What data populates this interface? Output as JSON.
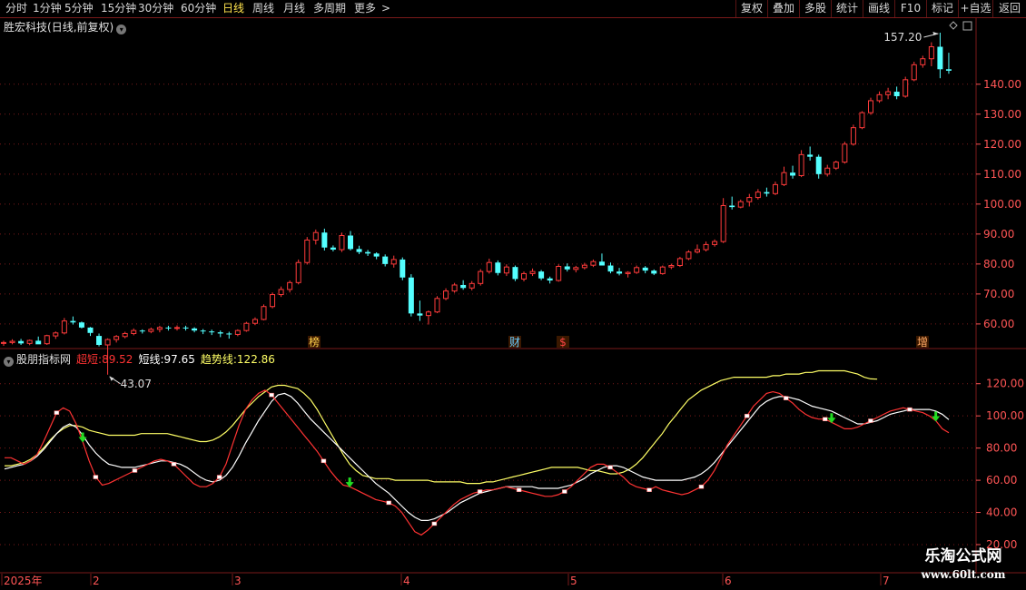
{
  "toolbar": {
    "periods": [
      "分时",
      "1分钟",
      "5分钟",
      "15分钟",
      "30分钟",
      "60分钟",
      "日线",
      "周线",
      "月线",
      "多周期",
      "更多"
    ],
    "active_period": "日线",
    "more_arrow": ">",
    "right_buttons": [
      "复权",
      "叠加",
      "多股",
      "统计",
      "画线",
      "F10",
      "标记",
      "+自选",
      "返回"
    ]
  },
  "stock": {
    "name": "胜宏科技",
    "mode": "(日线,前复权)"
  },
  "indicator": {
    "name": "股朋指标网",
    "legend": [
      {
        "label": "超短",
        "value": "89.52",
        "color": "#ff3333"
      },
      {
        "label": "短线",
        "value": "97.65",
        "color": "#ffffff"
      },
      {
        "label": "趋势线",
        "value": "122.86",
        "color": "#ffff66"
      }
    ]
  },
  "axis": {
    "price_ticks": [
      "140.00",
      "130.00",
      "120.00",
      "110.00",
      "100.00",
      "90.00",
      "80.00",
      "70.00",
      "60.00"
    ],
    "indicator_ticks": [
      "120.00",
      "100.00",
      "80.00",
      "60.00",
      "40.00",
      "20.00"
    ],
    "date_labels": [
      "2025年",
      "2",
      "3",
      "4",
      "5",
      "6",
      "7"
    ]
  },
  "annotations": {
    "high_label": "157.20",
    "low_label": "43.07",
    "event_markers": [
      {
        "text": "榜",
        "color": "#ffd24d"
      },
      {
        "text": "财",
        "color": "#66ccff"
      },
      {
        "text": "$",
        "color": "#ff4444"
      },
      {
        "text": "增",
        "color": "#ffaa66"
      }
    ]
  },
  "colors": {
    "up": "#ff3b3b",
    "down": "#54ffff",
    "grid": "#7a1a1a",
    "axis_text": "#ff5555",
    "trend": "#ffff66",
    "short": "#ffffff",
    "ultra": "#ff3333",
    "signal": "#22dd22"
  },
  "watermark": {
    "line1": "乐淘公式网",
    "line2": "www.60lt.com"
  },
  "chart_data": {
    "type": "candlestick",
    "price_ylim": [
      53,
      157.2
    ],
    "indicator_ylim": [
      20,
      130
    ],
    "candles": [
      [
        53.6,
        54.4,
        52.7,
        53.8
      ],
      [
        53.8,
        54.9,
        53.2,
        54.2
      ],
      [
        54.3,
        55.0,
        53.0,
        53.5
      ],
      [
        53.5,
        54.8,
        52.9,
        54.5
      ],
      [
        54.4,
        55.8,
        53.4,
        53.2
      ],
      [
        53.4,
        56.4,
        53.0,
        56.1
      ],
      [
        56.0,
        57.5,
        55.0,
        57.0
      ],
      [
        57.0,
        62.0,
        56.5,
        61.0
      ],
      [
        61.0,
        62.5,
        59.8,
        60.5
      ],
      [
        60.5,
        60.8,
        58.5,
        58.8
      ],
      [
        58.8,
        59.0,
        56.0,
        57.0
      ],
      [
        56.0,
        56.8,
        52.5,
        53.0
      ],
      [
        53.0,
        55.2,
        43.07,
        54.8
      ],
      [
        54.8,
        56.3,
        53.8,
        55.8
      ],
      [
        55.8,
        57.4,
        55.2,
        56.8
      ],
      [
        56.8,
        58.5,
        56.2,
        57.8
      ],
      [
        57.8,
        58.2,
        56.8,
        57.5
      ],
      [
        57.5,
        58.8,
        56.9,
        58.2
      ],
      [
        58.2,
        59.4,
        57.2,
        58.8
      ],
      [
        58.8,
        59.4,
        57.8,
        58.6
      ],
      [
        58.6,
        59.5,
        57.8,
        58.8
      ],
      [
        58.8,
        59.4,
        57.8,
        58.5
      ],
      [
        58.5,
        58.9,
        57.2,
        57.8
      ],
      [
        57.8,
        58.3,
        56.6,
        57.5
      ],
      [
        57.5,
        58.1,
        56.3,
        57.2
      ],
      [
        57.2,
        57.8,
        55.6,
        56.8
      ],
      [
        56.8,
        57.4,
        55.1,
        56.5
      ],
      [
        56.5,
        58.2,
        55.9,
        57.8
      ],
      [
        57.8,
        60.7,
        57.4,
        60.2
      ],
      [
        60.2,
        62.2,
        59.6,
        61.5
      ],
      [
        61.5,
        66.5,
        61.2,
        65.8
      ],
      [
        65.8,
        70.5,
        65.2,
        69.8
      ],
      [
        69.8,
        72.5,
        69.0,
        71.5
      ],
      [
        71.5,
        74.5,
        70.5,
        73.8
      ],
      [
        73.8,
        81.5,
        73.2,
        80.5
      ],
      [
        80.5,
        89.0,
        79.8,
        88.0
      ],
      [
        88.0,
        91.5,
        86.5,
        90.5
      ],
      [
        90.5,
        91.8,
        84.5,
        85.5
      ],
      [
        85.5,
        86.2,
        84.2,
        84.8
      ],
      [
        84.8,
        90.5,
        84.0,
        89.5
      ],
      [
        89.5,
        91.0,
        84.5,
        85.0
      ],
      [
        85.0,
        86.1,
        83.3,
        84.0
      ],
      [
        84.0,
        84.7,
        82.7,
        83.5
      ],
      [
        83.5,
        83.9,
        81.6,
        82.5
      ],
      [
        82.5,
        83.2,
        79.2,
        80.0
      ],
      [
        80.0,
        82.8,
        78.8,
        81.5
      ],
      [
        81.5,
        82.2,
        74.6,
        75.5
      ],
      [
        75.5,
        76.6,
        62.5,
        63.5
      ],
      [
        63.5,
        67.8,
        61.0,
        62.8
      ],
      [
        62.8,
        64.5,
        59.8,
        64.0
      ],
      [
        64.0,
        69.3,
        63.6,
        68.5
      ],
      [
        68.5,
        71.9,
        67.9,
        71.0
      ],
      [
        71.0,
        73.7,
        70.4,
        73.0
      ],
      [
        73.0,
        74.6,
        71.4,
        72.0
      ],
      [
        72.0,
        74.3,
        71.2,
        73.5
      ],
      [
        73.5,
        78.3,
        72.8,
        77.5
      ],
      [
        77.5,
        81.8,
        76.8,
        80.5
      ],
      [
        80.5,
        81.2,
        76.2,
        77.0
      ],
      [
        77.0,
        79.9,
        76.0,
        79.0
      ],
      [
        79.0,
        79.5,
        74.3,
        75.0
      ],
      [
        75.0,
        77.5,
        74.2,
        76.8
      ],
      [
        76.8,
        78.5,
        76.0,
        77.5
      ],
      [
        77.5,
        78.0,
        74.6,
        75.2
      ],
      [
        75.2,
        75.8,
        73.5,
        74.5
      ],
      [
        74.5,
        79.9,
        74.1,
        79.2
      ],
      [
        79.2,
        80.2,
        77.5,
        78.2
      ],
      [
        78.2,
        79.4,
        77.2,
        78.8
      ],
      [
        78.8,
        80.4,
        78.2,
        79.6
      ],
      [
        79.6,
        81.5,
        79.0,
        80.8
      ],
      [
        80.8,
        83.5,
        80.1,
        79.5
      ],
      [
        79.5,
        80.5,
        76.9,
        77.5
      ],
      [
        77.5,
        78.7,
        76.2,
        76.8
      ],
      [
        76.8,
        77.6,
        75.5,
        77.2
      ],
      [
        77.2,
        79.5,
        76.7,
        78.8
      ],
      [
        78.8,
        79.3,
        76.9,
        77.8
      ],
      [
        77.8,
        78.2,
        76.3,
        76.8
      ],
      [
        76.8,
        79.5,
        76.4,
        79.0
      ],
      [
        79.0,
        80.1,
        78.3,
        79.5
      ],
      [
        79.5,
        82.4,
        79.0,
        81.8
      ],
      [
        81.8,
        84.6,
        81.3,
        84.0
      ],
      [
        84.0,
        86.5,
        83.5,
        84.8
      ],
      [
        84.8,
        87.5,
        84.2,
        86.5
      ],
      [
        86.5,
        88.2,
        85.8,
        87.5
      ],
      [
        87.5,
        102.0,
        87.0,
        99.5
      ],
      [
        99.5,
        102.5,
        98.2,
        99.0
      ],
      [
        99.0,
        101.5,
        98.6,
        100.8
      ],
      [
        100.8,
        103.4,
        99.2,
        102.2
      ],
      [
        102.2,
        105.0,
        101.5,
        104.0
      ],
      [
        104.0,
        105.5,
        102.5,
        103.5
      ],
      [
        103.5,
        107.5,
        103.0,
        106.5
      ],
      [
        106.5,
        112.5,
        106.0,
        110.5
      ],
      [
        110.5,
        112.8,
        108.5,
        109.5
      ],
      [
        109.5,
        118.0,
        109.0,
        116.5
      ],
      [
        116.5,
        119.2,
        114.5,
        115.8
      ],
      [
        115.8,
        116.5,
        108.5,
        110.0
      ],
      [
        110.0,
        113.1,
        109.2,
        112.0
      ],
      [
        112.0,
        114.5,
        111.4,
        114.0
      ],
      [
        114.0,
        120.8,
        113.5,
        120.0
      ],
      [
        120.0,
        126.5,
        119.5,
        125.5
      ],
      [
        125.5,
        131.0,
        125.0,
        130.5
      ],
      [
        130.5,
        135.5,
        129.8,
        134.5
      ],
      [
        134.5,
        137.6,
        133.8,
        136.5
      ],
      [
        136.5,
        138.8,
        135.0,
        137.5
      ],
      [
        137.5,
        139.2,
        135.0,
        136.0
      ],
      [
        136.0,
        142.5,
        135.5,
        141.5
      ],
      [
        141.5,
        147.5,
        141.0,
        146.5
      ],
      [
        146.5,
        149.5,
        145.5,
        148.5
      ],
      [
        148.5,
        154.0,
        146.0,
        152.5
      ],
      [
        152.5,
        157.2,
        142.0,
        145.0
      ],
      [
        145.0,
        150.5,
        143.5,
        144.5
      ]
    ],
    "series": [
      {
        "name": "超短",
        "values": [
          74,
          74,
          72,
          70,
          72,
          76,
          84,
          93,
          102,
          105,
          103,
          95,
          84,
          72,
          62,
          57,
          58,
          60,
          62,
          64,
          66,
          68,
          70,
          72,
          73,
          72,
          70,
          66,
          62,
          58,
          56,
          56,
          58,
          62,
          70,
          82,
          94,
          104,
          110,
          114,
          116,
          113,
          108,
          103,
          98,
          93,
          88,
          83,
          78,
          72,
          66,
          61,
          57,
          56,
          54,
          52,
          50,
          48,
          47,
          46,
          44,
          40,
          34,
          28,
          26,
          29,
          33,
          37,
          41,
          45,
          48,
          50,
          52,
          53,
          54,
          54,
          55,
          56,
          55,
          54,
          53,
          52,
          51,
          50,
          50,
          51,
          53,
          56,
          60,
          64,
          68,
          70,
          70,
          68,
          65,
          62,
          58,
          56,
          55,
          54,
          56,
          54,
          53,
          52,
          51,
          52,
          54,
          56,
          60,
          66,
          74,
          82,
          88,
          94,
          100,
          106,
          110,
          114,
          115,
          114,
          111,
          108,
          104,
          101,
          99,
          98,
          98,
          96,
          94,
          92,
          92,
          93,
          95,
          97,
          99,
          101,
          103,
          104,
          105,
          104,
          103,
          102,
          100,
          97,
          92,
          89.52
        ]
      },
      {
        "name": "短线",
        "values": [
          67,
          68,
          69,
          70,
          72,
          75,
          79,
          84,
          89,
          93,
          95,
          93,
          88,
          82,
          77,
          73,
          70,
          69,
          68,
          68,
          68,
          69,
          70,
          71,
          72,
          72,
          71,
          70,
          68,
          65,
          62,
          60,
          59,
          60,
          63,
          68,
          75,
          83,
          90,
          97,
          103,
          109,
          113,
          114,
          112,
          108,
          103,
          98,
          94,
          90,
          86,
          82,
          78,
          74,
          70,
          66,
          62,
          58,
          55,
          52,
          48,
          44,
          40,
          37,
          35,
          35,
          36,
          38,
          40,
          43,
          46,
          48,
          50,
          52,
          53,
          54,
          55,
          56,
          56,
          56,
          56,
          56,
          55,
          55,
          55,
          55,
          56,
          57,
          59,
          61,
          64,
          66,
          68,
          69,
          69,
          68,
          66,
          64,
          62,
          61,
          60,
          60,
          60,
          60,
          60,
          61,
          62,
          64,
          67,
          71,
          76,
          81,
          86,
          91,
          96,
          101,
          106,
          109,
          111,
          112,
          112,
          111,
          110,
          108,
          106,
          105,
          104,
          103,
          101,
          99,
          97,
          95,
          95,
          96,
          97,
          99,
          101,
          102,
          103,
          104,
          104,
          104,
          104,
          103,
          101,
          97.65
        ]
      },
      {
        "name": "趋势线",
        "values": [
          69,
          69,
          70,
          71,
          73,
          76,
          80,
          85,
          89,
          92,
          94,
          94,
          93,
          91,
          90,
          89,
          88,
          88,
          88,
          88,
          88,
          89,
          89,
          89,
          89,
          89,
          88,
          87,
          86,
          85,
          84,
          84,
          85,
          87,
          90,
          94,
          99,
          104,
          108,
          112,
          115,
          118,
          119,
          119,
          118,
          117,
          114,
          110,
          104,
          97,
          90,
          83,
          76,
          70,
          66,
          63,
          62,
          61,
          61,
          61,
          60,
          60,
          60,
          60,
          60,
          60,
          59,
          59,
          59,
          59,
          59,
          58,
          58,
          58,
          59,
          59,
          60,
          61,
          62,
          63,
          64,
          65,
          66,
          67,
          68,
          68,
          68,
          68,
          68,
          67,
          66,
          66,
          65,
          64,
          64,
          65,
          67,
          70,
          74,
          79,
          84,
          89,
          95,
          100,
          105,
          110,
          113,
          116,
          118,
          120,
          122,
          123,
          124,
          124,
          124,
          124,
          124,
          124,
          125,
          125,
          126,
          126,
          126,
          127,
          127,
          128,
          128,
          128,
          128,
          128,
          127,
          126,
          124,
          123,
          122.86
        ]
      }
    ]
  }
}
